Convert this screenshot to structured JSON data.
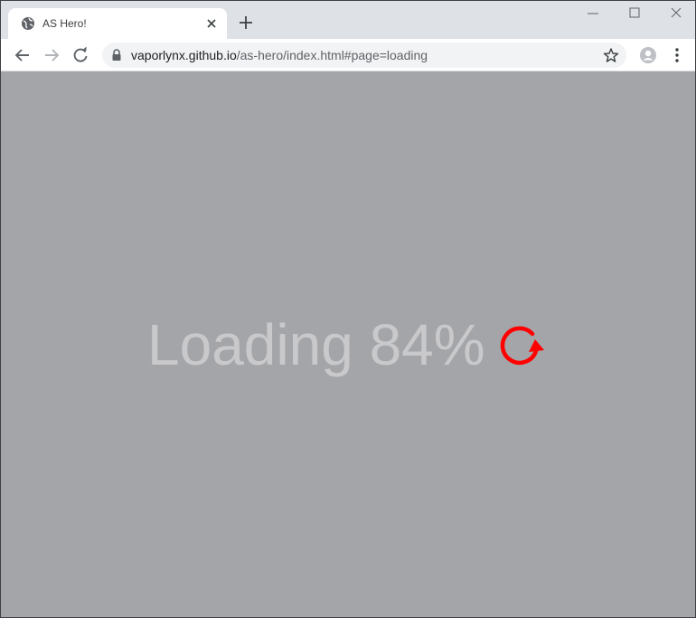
{
  "browser": {
    "tab": {
      "title": "AS Hero!",
      "favicon": "globe-icon"
    },
    "toolbar": {
      "url_host": "vaporlynx.github.io",
      "url_path": "/as-hero/index.html#page=loading"
    }
  },
  "page": {
    "loading_text": "Loading 84%",
    "progress_percent": 84,
    "spinner_color": "#ff0000",
    "background_color": "#a4a5a8",
    "text_color": "#c9c9cb"
  }
}
